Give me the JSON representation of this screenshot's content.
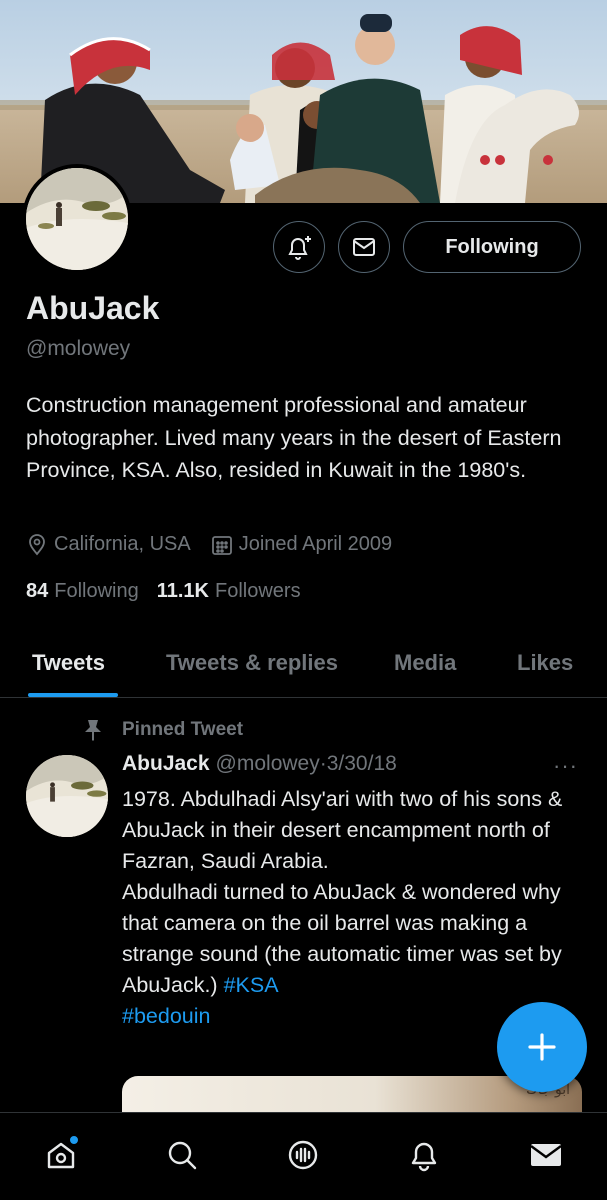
{
  "profile": {
    "display_name": "AbuJack",
    "handle": "@molowey",
    "bio": "Construction management professional and amateur photographer. Lived many years in the desert of Eastern Province, KSA. Also, resided in Kuwait in the 1980's.",
    "location": "California, USA",
    "joined": "Joined April 2009",
    "following_count": "84",
    "following_label": "Following",
    "followers_count": "11.1K",
    "followers_label": "Followers",
    "follow_button_label": "Following"
  },
  "tabs": [
    {
      "label": "Tweets",
      "active": true
    },
    {
      "label": "Tweets & replies",
      "active": false
    },
    {
      "label": "Media",
      "active": false
    },
    {
      "label": "Likes",
      "active": false
    }
  ],
  "pinned_tweet": {
    "pinned_label": "Pinned Tweet",
    "author_name": "AbuJack",
    "author_handle": "@molowey",
    "separator": " · ",
    "date": "3/30/18",
    "more": "···",
    "text": "1978. Abdulhadi Alsy'ari with two of his sons & AbuJack in their desert encampment north of Fazran, Saudi Arabia.\nAbdulhadi turned to AbuJack & wondered why that camera on the oil barrel was making a strange sound (the automatic timer was set by AbuJack.) ",
    "hashtags": [
      "#KSA",
      "#bedouin"
    ],
    "media_watermark": "ابو جاك"
  },
  "icons": {
    "bell": "bell-plus-icon",
    "message": "envelope-icon",
    "location": "location-pin-icon",
    "calendar": "calendar-icon",
    "pin": "pin-icon",
    "compose": "plus-icon",
    "nav": [
      "home-icon",
      "search-icon",
      "spaces-icon",
      "notifications-icon",
      "messages-icon"
    ]
  },
  "colors": {
    "accent": "#1d9bf0",
    "background": "#000000",
    "text_primary": "#e7e9ea",
    "text_secondary": "#71767b"
  }
}
